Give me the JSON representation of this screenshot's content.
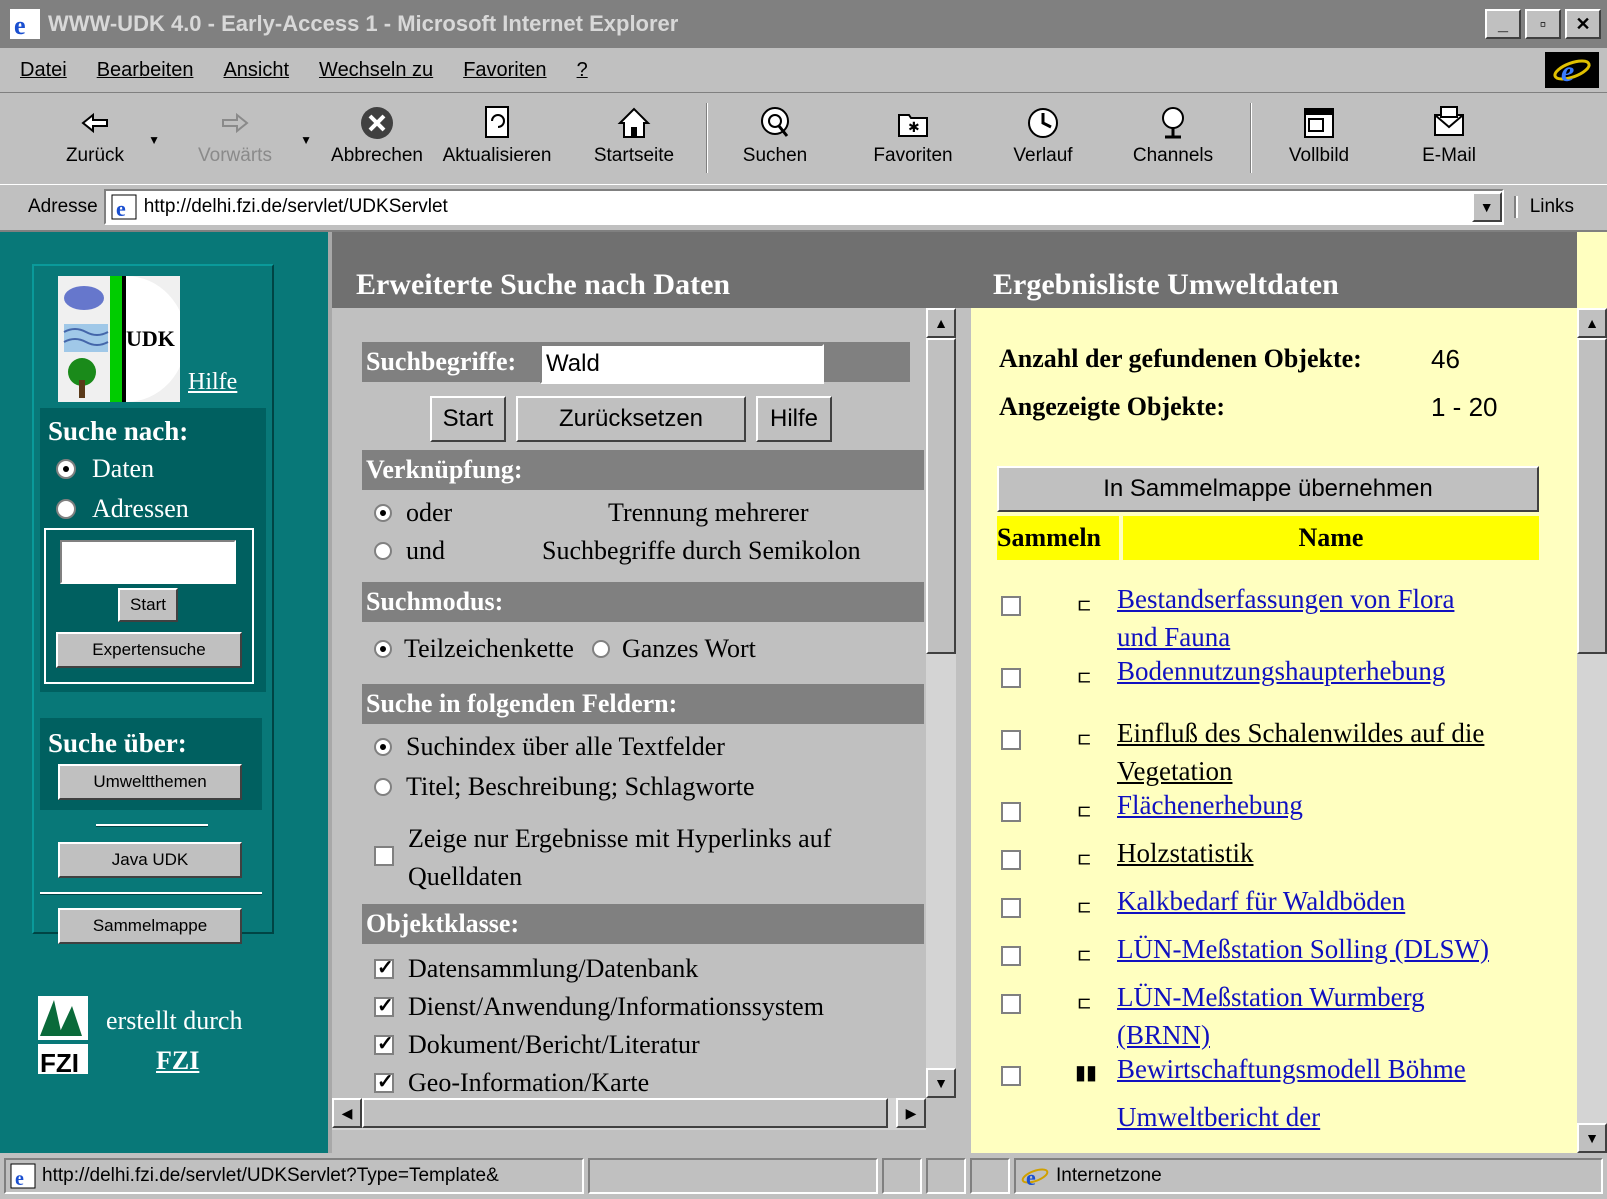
{
  "window": {
    "title": "WWW-UDK 4.0 - Early-Access 1 - Microsoft Internet Explorer"
  },
  "menu": {
    "items": [
      "Datei",
      "Bearbeiten",
      "Ansicht",
      "Wechseln zu",
      "Favoriten",
      "?"
    ]
  },
  "toolbar": {
    "back": "Zurück",
    "forward": "Vorwärts",
    "stop": "Abbrechen",
    "refresh": "Aktualisieren",
    "home": "Startseite",
    "search": "Suchen",
    "favorites": "Favoriten",
    "history": "Verlauf",
    "channels": "Channels",
    "fullscreen": "Vollbild",
    "mail": "E-Mail"
  },
  "address": {
    "label": "Adresse",
    "url": "http://delhi.fzi.de/servlet/UDKServlet",
    "links": "Links"
  },
  "left": {
    "logo_text": "UDK",
    "hilfe": "Hilfe",
    "search_for_heading": "Suche nach:",
    "radio_daten": "Daten",
    "radio_adressen": "Adressen",
    "search_value": "",
    "start": "Start",
    "expert": "Expertensuche",
    "search_over_heading": "Suche über:",
    "topics": "Umweltthemen",
    "java": "Java UDK",
    "collection": "Sammelmappe",
    "created_by": "erstellt durch",
    "fzi": "FZI"
  },
  "middle": {
    "header": "Erweiterte Suche nach Daten",
    "terms_label": "Suchbegriffe:",
    "terms_value": "Wald",
    "btn_start": "Start",
    "btn_reset": "Zurücksetzen",
    "btn_help": "Hilfe",
    "link_section": "Verknüpfung:",
    "opt_or": "oder",
    "opt_and": "und",
    "link_hint_1": "Trennung mehrerer",
    "link_hint_2": "Suchbegriffe durch Semikolon",
    "mode_section": "Suchmodus:",
    "mode_partial": "Teilzeichenkette",
    "mode_whole": "Ganzes Wort",
    "fields_section": "Suche in folgenden Feldern:",
    "field_all": "Suchindex über alle Textfelder",
    "field_title": "Titel; Beschreibung; Schlagworte",
    "hyperlinks_1": "Zeige nur Ergebnisse mit Hyperlinks auf",
    "hyperlinks_2": "Quelldaten",
    "class_section": "Objektklasse:",
    "classes": [
      "Datensammlung/Datenbank",
      "Dienst/Anwendung/Informationssystem",
      "Dokument/Bericht/Literatur",
      "Geo-Information/Karte"
    ]
  },
  "right": {
    "header": "Ergebnisliste Umweltdaten",
    "count_label": "Anzahl der gefundenen Objekte:",
    "count_value": "46",
    "shown_label": "Angezeigte Objekte:",
    "shown_value": "1 - 20",
    "collect_button": "In Sammelmappe übernehmen",
    "col_collect": "Sammeln",
    "col_name": "Name",
    "results": [
      {
        "l1": "Bestandserfassungen von Flora",
        "l2": "und Fauna",
        "visited": false
      },
      {
        "l1": "Bodennutzungshaupterhebung",
        "l2": "",
        "visited": false
      },
      {
        "l1": "Einfluß des Schalenwildes auf die",
        "l2": "Vegetation",
        "visited": true
      },
      {
        "l1": "Flächenerhebung",
        "l2": "",
        "visited": false
      },
      {
        "l1": "Holzstatistik",
        "l2": "",
        "visited": true
      },
      {
        "l1": "Kalkbedarf für Waldböden",
        "l2": "",
        "visited": false
      },
      {
        "l1": "LÜN-Meßstation Solling (DLSW)",
        "l2": "",
        "visited": false
      },
      {
        "l1": "LÜN-Meßstation Wurmberg",
        "l2": "(BRNN)",
        "visited": false
      },
      {
        "l1": "Bewirtschaftungsmodell Böhme",
        "l2": "",
        "visited": false
      },
      {
        "l1": "Umweltbericht der",
        "l2": "",
        "visited": false
      }
    ]
  },
  "status": {
    "url": "http://delhi.fzi.de/servlet/UDKServlet?Type=Template&",
    "zone": "Internetzone"
  },
  "colors": {
    "left_bg": "#087878",
    "result_bg": "#ffffc0",
    "header_yellow": "#ffff00",
    "link": "#1010c0"
  }
}
